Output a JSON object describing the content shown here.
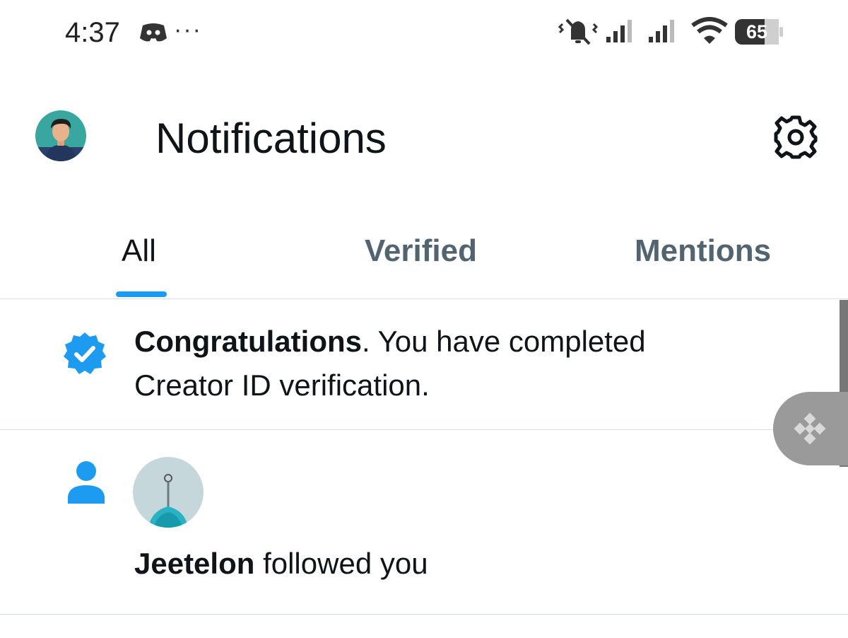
{
  "status_bar": {
    "time": "4:37",
    "dots": "···",
    "battery": "65",
    "icons": [
      "discord-icon",
      "mute-vibrate-icon",
      "signal-icon",
      "signal-icon",
      "wifi-icon",
      "battery-icon"
    ]
  },
  "header": {
    "title": "Notifications",
    "avatar_icon": "profile-avatar",
    "settings_icon": "gear-icon"
  },
  "tabs": [
    {
      "label": "All",
      "active": true
    },
    {
      "label": "Verified",
      "active": false
    },
    {
      "label": "Mentions",
      "active": false
    }
  ],
  "notifications": [
    {
      "icon": "verified-badge-icon",
      "bold": "Congratulations",
      "text_line1": ".  You have completed",
      "text_line2": "Creator ID verification."
    },
    {
      "icon": "person-icon",
      "bold": "Jeetelon",
      "text": " followed you"
    }
  ],
  "colors": {
    "accent": "#1d9bf0",
    "text_primary": "#0f1419",
    "text_secondary": "#536471",
    "divider": "#d8dde1"
  }
}
